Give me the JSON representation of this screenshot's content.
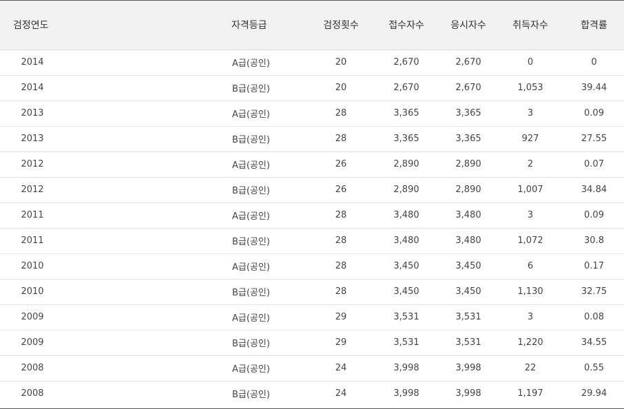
{
  "table": {
    "headers": [
      "검정연도",
      "자격등급",
      "검정횟수",
      "접수자수",
      "응시자수",
      "취득자수",
      "합격률"
    ],
    "rows": [
      [
        "2014",
        "A급(공인)",
        "20",
        "2,670",
        "2,670",
        "0",
        "0"
      ],
      [
        "2014",
        "B급(공인)",
        "20",
        "2,670",
        "2,670",
        "1,053",
        "39.44"
      ],
      [
        "2013",
        "A급(공인)",
        "28",
        "3,365",
        "3,365",
        "3",
        "0.09"
      ],
      [
        "2013",
        "B급(공인)",
        "28",
        "3,365",
        "3,365",
        "927",
        "27.55"
      ],
      [
        "2012",
        "A급(공인)",
        "26",
        "2,890",
        "2,890",
        "2",
        "0.07"
      ],
      [
        "2012",
        "B급(공인)",
        "26",
        "2,890",
        "2,890",
        "1,007",
        "34.84"
      ],
      [
        "2011",
        "A급(공인)",
        "28",
        "3,480",
        "3,480",
        "3",
        "0.09"
      ],
      [
        "2011",
        "B급(공인)",
        "28",
        "3,480",
        "3,480",
        "1,072",
        "30.8"
      ],
      [
        "2010",
        "A급(공인)",
        "28",
        "3,450",
        "3,450",
        "6",
        "0.17"
      ],
      [
        "2010",
        "B급(공인)",
        "28",
        "3,450",
        "3,450",
        "1,130",
        "32.75"
      ],
      [
        "2009",
        "A급(공인)",
        "29",
        "3,531",
        "3,531",
        "3",
        "0.08"
      ],
      [
        "2009",
        "B급(공인)",
        "29",
        "3,531",
        "3,531",
        "1,220",
        "34.55"
      ],
      [
        "2008",
        "A급(공인)",
        "24",
        "3,998",
        "3,998",
        "22",
        "0.55"
      ],
      [
        "2008",
        "B급(공인)",
        "24",
        "3,998",
        "3,998",
        "1,197",
        "29.94"
      ]
    ]
  }
}
